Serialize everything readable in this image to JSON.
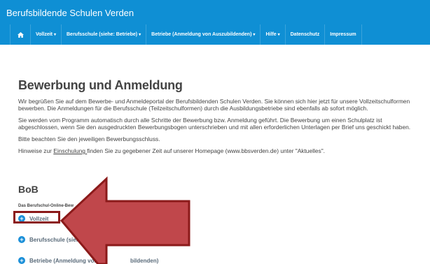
{
  "header": {
    "site_title": "Berufsbildende Schulen Verden"
  },
  "nav": {
    "home_icon": "home-icon",
    "items": [
      {
        "label": "Vollzeit",
        "dropdown": true
      },
      {
        "label": "Berufsschule (siehe: Betriebe)",
        "dropdown": true
      },
      {
        "label": "Betriebe (Anmeldung von Auszubildenden)",
        "dropdown": true
      },
      {
        "label": "Hilfe",
        "dropdown": true
      },
      {
        "label": "Datenschutz",
        "dropdown": false
      },
      {
        "label": "Impressum",
        "dropdown": false
      }
    ]
  },
  "main": {
    "title": "Bewerbung und Anmeldung",
    "p1": "Wir begrüßen Sie auf dem Bewerbe- und Anmeldeportal der Berufsbildenden Schulen Verden. Sie können sich hier jetzt für unsere Vollzeitschulformen bewerben. Die Anmeldungen für die Berufsschule (Teilzeitschulformen) durch die Ausbildungsbetriebe sind ebenfalls ab sofort möglich.",
    "p2": "Sie werden vom Programm automatisch durch alle Schritte der Bewerbung bzw. Anmeldung geführt. Die Bewerbung um einen Schulplatz ist abgeschlossen, wenn Sie den ausgedruckten Bewerbungsbogen unterschrieben und mit allen erforderlichen Unterlagen per Brief uns geschickt haben.",
    "p3": "Bitte beachten Sie den jeweiligen Bewerbungsschluss.",
    "p4_before": "Hinweise zur ",
    "p4_link": "Einschulung ",
    "p4_after": "finden Sie zu gegebener Zeit auf unserer Homepage (www.bbsverden.de) unter \"Aktuelles\"."
  },
  "bob": {
    "title": "BoB",
    "subtitle": "Das Berufschul-Online-Bew",
    "items": [
      {
        "label": "Vollzeit"
      },
      {
        "label": "Berufsschule (siehe"
      },
      {
        "label": "Betriebe (Anmeldung von Au",
        "label_tail": "bildenden)"
      }
    ]
  },
  "colors": {
    "header_bg": "#0f8fd4",
    "arrow_fill": "#c0474b",
    "arrow_stroke": "#8b1a1a"
  }
}
